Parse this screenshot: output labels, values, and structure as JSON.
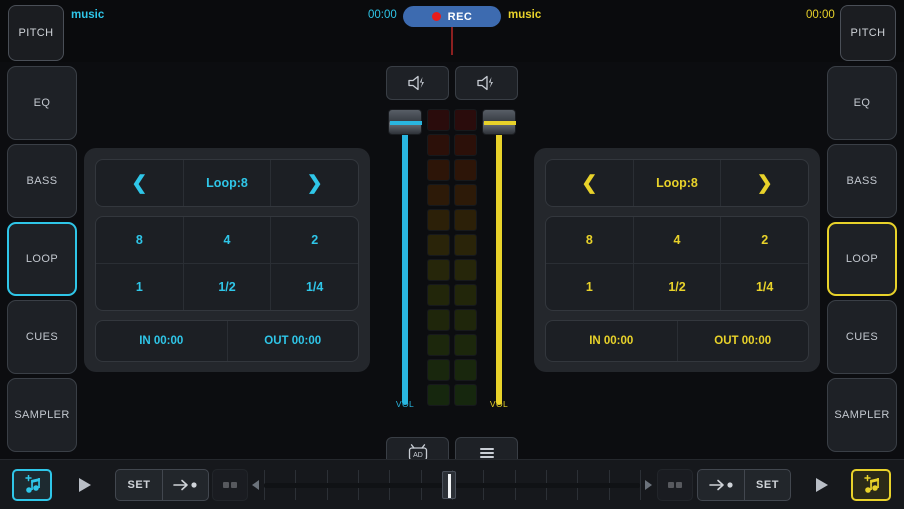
{
  "header": {
    "pitch_left_label": "PITCH",
    "pitch_right_label": "PITCH",
    "deck_a_track": "music",
    "deck_b_track": "music",
    "deck_a_time": "00:00",
    "deck_b_time": "00:00",
    "rec_label": "REC",
    "rec_color": "#3d6bb0",
    "rec_dot_color": "#e81c1c"
  },
  "colors": {
    "deck_a": "#2fc6e8",
    "deck_b": "#e8d22a",
    "panel": "#24272c",
    "button": "#1e2126",
    "background": "#0c0d10"
  },
  "sidebar_left": {
    "items": [
      {
        "label": "EQ",
        "active": false
      },
      {
        "label": "BASS",
        "active": false
      },
      {
        "label": "LOOP",
        "active": true
      },
      {
        "label": "CUES",
        "active": false
      },
      {
        "label": "SAMPLER",
        "active": false
      }
    ]
  },
  "sidebar_right": {
    "items": [
      {
        "label": "EQ",
        "active": false
      },
      {
        "label": "BASS",
        "active": false
      },
      {
        "label": "LOOP",
        "active": true
      },
      {
        "label": "CUES",
        "active": false
      },
      {
        "label": "SAMPLER",
        "active": false
      }
    ]
  },
  "loop_a": {
    "prev_icon": "chevron-left-icon",
    "next_icon": "chevron-right-icon",
    "title": "Loop:8",
    "beats_row1": [
      "8",
      "4",
      "2"
    ],
    "beats_row2": [
      "1",
      "1/2",
      "1/4"
    ],
    "in_label": "IN 00:00",
    "out_label": "OUT 00:00"
  },
  "loop_b": {
    "prev_icon": "chevron-left-icon",
    "next_icon": "chevron-right-icon",
    "title": "Loop:8",
    "beats_row1": [
      "8",
      "4",
      "2"
    ],
    "beats_row2": [
      "1",
      "1/2",
      "1/4"
    ],
    "in_label": "IN 00:00",
    "out_label": "OUT 00:00"
  },
  "mixer": {
    "speaker_a_icon": "speaker-bolt-icon",
    "speaker_b_icon": "speaker-bolt-icon",
    "vol_a_label": "VOL",
    "vol_b_label": "VOL",
    "fader_a_position_pct": 100,
    "fader_b_position_pct": 100,
    "vu_rows": 12,
    "vu_columns": 2,
    "vu_level_a": 0,
    "vu_level_b": 0,
    "vu_gradient": [
      "#2a0c0c",
      "#2c1009",
      "#2d1508",
      "#2d1a08",
      "#2c2008",
      "#2a2409",
      "#26260a",
      "#22260a",
      "#1f260b",
      "#1c270c",
      "#19270d",
      "#16270e"
    ],
    "ad_button_icon": "ad-tv-icon",
    "menu_button_icon": "hamburger-menu-icon"
  },
  "bottombar": {
    "left": {
      "load_icon": "music-note-add-icon",
      "load_active": true,
      "play_icon": "play-icon",
      "set_label": "SET",
      "cue_icon": "arrow-to-dot-icon",
      "pads_icon": "pads-icon",
      "pads_disabled": true
    },
    "right": {
      "load_icon": "music-note-add-icon",
      "load_active": true,
      "play_icon": "play-icon",
      "set_label": "SET",
      "cue_icon": "arrow-to-dot-icon",
      "pads_icon": "pads-icon",
      "pads_disabled": true
    },
    "crossfader": {
      "position_pct": 50,
      "left_arrow_icon": "triangle-left-icon",
      "right_arrow_icon": "triangle-right-icon",
      "ticks": 13
    }
  }
}
